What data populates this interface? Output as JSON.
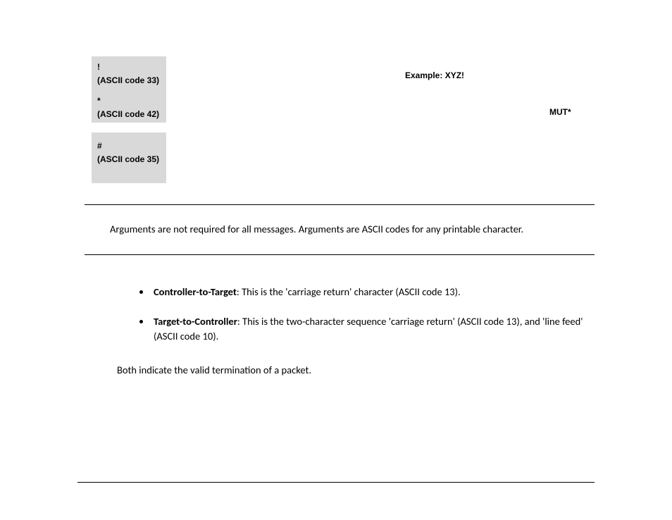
{
  "table": {
    "rows": [
      {
        "symbol": "!",
        "code_label": "(ASCII code 33)"
      },
      {
        "symbol": "*",
        "code_label": "(ASCII code 42)"
      },
      {
        "symbol": "#",
        "code_label": "(ASCII code 35)"
      }
    ],
    "example_label": "Example: XYZ!",
    "mut_label": "MUT*"
  },
  "arguments_note": "Arguments are not required for all messages. Arguments are ASCII codes for any printable character.",
  "items": [
    {
      "heading": "Controller-to-Target",
      "text": ": This is the 'carriage return' character (ASCII code 13)."
    },
    {
      "heading": "Target-to-Controller",
      "text": ": This is the two-character sequence 'carriage return' (ASCII code 13), and 'line feed' (ASCII code 10)."
    }
  ],
  "termination_note": "Both indicate the valid termination of a packet."
}
